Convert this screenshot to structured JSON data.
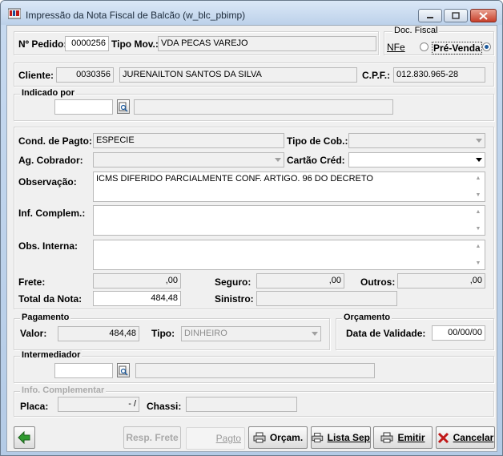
{
  "window": {
    "title": "Impressão da Nota Fiscal de Balcão (w_blc_pbimp)"
  },
  "header": {
    "pedido_label": "Nº Pedido:",
    "pedido_value": "0000256",
    "tipo_mov_label": "Tipo Mov.:",
    "tipo_mov_value": "VDA PECAS VAREJO"
  },
  "doc_fiscal": {
    "title": "Doc. Fiscal",
    "nfe_label": "NFe",
    "pre_venda_label": "Pré-Venda",
    "selected": "Pré-Venda"
  },
  "cliente": {
    "label": "Cliente:",
    "code": "0030356",
    "name": "JURENAILTON SANTOS DA SILVA",
    "cpf_label": "C.P.F.:",
    "cpf_value": "012.830.965-28"
  },
  "indicado_por": {
    "title": "Indicado por",
    "code": "",
    "name": ""
  },
  "details": {
    "cond_pagto_label": "Cond. de Pagto:",
    "cond_pagto_value": "ESPECIE",
    "tipo_cob_label": "Tipo de Cob.:",
    "tipo_cob_value": "",
    "ag_cobrador_label": "Ag. Cobrador:",
    "ag_cobrador_value": "",
    "cartao_cred_label": "Cartão Créd:",
    "cartao_cred_value": "",
    "observacao_label": "Observação:",
    "observacao_value": "ICMS DIFERIDO PARCIALMENTE CONF. ARTIGO. 96 DO DECRETO",
    "inf_complem_label": "Inf. Complem.:",
    "inf_complem_value": "",
    "obs_interna_label": "Obs. Interna:",
    "obs_interna_value": "",
    "frete_label": "Frete:",
    "frete_value": ",00",
    "seguro_label": "Seguro:",
    "seguro_value": ",00",
    "outros_label": "Outros:",
    "outros_value": ",00",
    "total_label": "Total da Nota:",
    "total_value": "484,48",
    "sinistro_label": "Sinistro:",
    "sinistro_value": ""
  },
  "pagamento": {
    "title": "Pagamento",
    "valor_label": "Valor:",
    "valor_value": "484,48",
    "tipo_label": "Tipo:",
    "tipo_value": "DINHEIRO"
  },
  "orcamento": {
    "title": "Orçamento",
    "validade_label": "Data de Validade:",
    "validade_value": "00/00/00"
  },
  "intermediador": {
    "title": "Intermediador",
    "code": "",
    "name": ""
  },
  "info_complementar": {
    "title": "Info. Complementar",
    "placa_label": "Placa:",
    "placa_value": "-  /",
    "chassi_label": "Chassi:",
    "chassi_value": ""
  },
  "toolbar": {
    "resp_frete": "Resp. Frete",
    "pagto": "Pagto",
    "orcam": "Orçam.",
    "lista_sep": "Lista Sep",
    "emitir": "Emitir",
    "cancelar": "Cancelar"
  },
  "colors": {
    "accent": "#1d5a9c",
    "close": "#c8402b",
    "exit_green": "#2e9a2e"
  },
  "icons": [
    "app-icon",
    "minimize-icon",
    "maximize-icon",
    "close-icon",
    "lookup-icon",
    "exit-arrow-icon",
    "printer-icon",
    "cancel-x-icon"
  ]
}
